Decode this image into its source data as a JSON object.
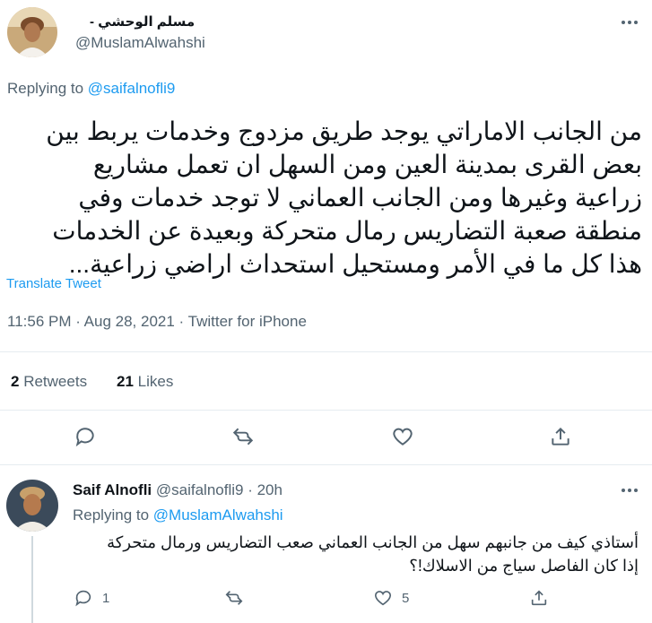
{
  "tweet": {
    "author_name": "مسلم الوحشي -",
    "author_handle": "@MuslamAlwahshi",
    "replying_label": "Replying to ",
    "replying_handle": "@saifalnofli9",
    "text_lines": [
      "من الجانب الاماراتي يوجد طريق مزدوج وخدمات يربط بين",
      "بعض القرى بمدينة العين ومن السهل ان تعمل مشاريع",
      "زراعية وغيرها ومن الجانب العماني لا توجد خدمات وفي",
      "منطقة صعبة التضاريس رمال متحركة وبعيدة عن الخدمات",
      "هذا كل ما في الأمر ومستحيل استحداث اراضي زراعية..."
    ],
    "translate_label": "Translate Tweet",
    "meta": "11:56 PM · Aug 28, 2021 · Twitter for iPhone",
    "retweets_count": "2",
    "retweets_label": "Retweets",
    "likes_count": "21",
    "likes_label": "Likes"
  },
  "actions": {
    "reply_icon": "reply-icon",
    "retweet_icon": "retweet-icon",
    "like_icon": "heart-icon",
    "share_icon": "share-icon"
  },
  "reply": {
    "author_name": "Saif Alnofli",
    "author_handle": "@saifalnofli9 · 20h",
    "replying_label": "Replying to ",
    "replying_handle": "@MuslamAlwahshi",
    "text_lines": [
      "أستاذي كيف من جانبهم سهل من الجانب العماني  صعب التضاريس ورمال متحركة",
      "إذا كان الفاصل سياج من الاسلاك!؟"
    ],
    "reply_count": "1",
    "like_count": "5"
  },
  "colors": {
    "link": "#1d9bf0",
    "muted": "#536471",
    "text": "#0f1419"
  }
}
